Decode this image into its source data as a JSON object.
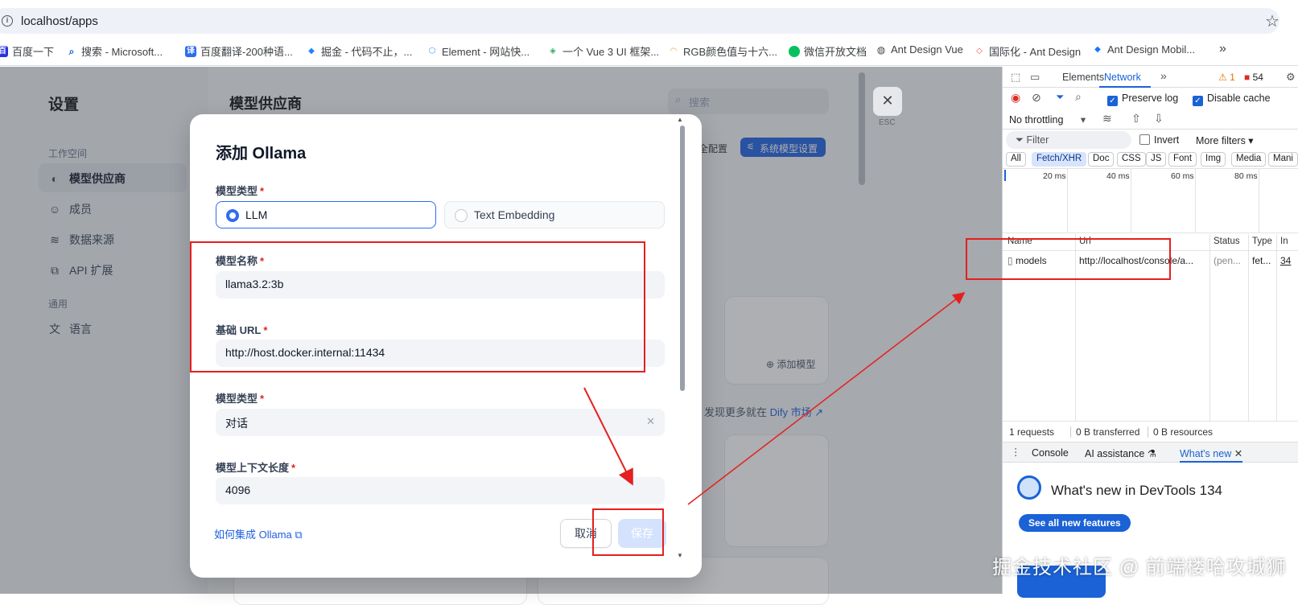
{
  "browser": {
    "url": "localhost/apps",
    "bookmarks": [
      {
        "label": "百度一下",
        "icon": "baidu-icon",
        "color": "#2932e1"
      },
      {
        "label": "搜索 - Microsoft...",
        "icon": "search-icon",
        "color": "#1a62d6"
      },
      {
        "label": "百度翻译-200种语...",
        "icon": "translate-icon",
        "color": "#2a6cf0"
      },
      {
        "label": "掘金 - 代码不止，...",
        "icon": "juejin-icon",
        "color": "#1e80ff"
      },
      {
        "label": "Element - 网站快...",
        "icon": "element-icon",
        "color": "#409eff"
      },
      {
        "label": "一个 Vue 3 UI 框架...",
        "icon": "naive-ui-icon",
        "color": "#36ad6a"
      },
      {
        "label": "RGB颜色值与十六...",
        "icon": "rainbow-icon",
        "color": "#e8a23a"
      },
      {
        "label": "微信开放文档",
        "icon": "wechat-icon",
        "color": "#07c160"
      },
      {
        "label": "Ant Design Vue",
        "icon": "globe-icon",
        "color": "#444444"
      },
      {
        "label": "国际化 - Ant Design",
        "icon": "antd-icon",
        "color": "#f04f4f"
      },
      {
        "label": "Ant Design Mobil...",
        "icon": "antd-mobile-icon",
        "color": "#1677ff"
      }
    ],
    "overflow": "»"
  },
  "sidebar": {
    "title": "设置",
    "group_workspace": "工作空间",
    "items": [
      {
        "label": "模型供应商",
        "icon": "brain-icon"
      },
      {
        "label": "成员",
        "icon": "members-icon"
      },
      {
        "label": "数据来源",
        "icon": "database-icon"
      },
      {
        "label": "API 扩展",
        "icon": "puzzle-icon"
      }
    ],
    "group_general": "通用",
    "language": {
      "label": "语言",
      "icon": "translate-icon"
    }
  },
  "main": {
    "title": "模型供应商",
    "search_placeholder": "搜索",
    "safe_config": "全配置",
    "system_model_settings": "系统模型设置",
    "add_model": "添加模型",
    "discover_prefix": "发现更多就在",
    "discover_link": "Dify 市场",
    "close_hint": "ESC"
  },
  "modal": {
    "title": "添加 Ollama",
    "model_type_label": "模型类型",
    "model_type_options": [
      "LLM",
      "Text Embedding"
    ],
    "model_type_selected": "LLM",
    "model_name_label": "模型名称",
    "model_name_value": "llama3.2:3b",
    "base_url_label": "基础 URL",
    "base_url_value": "http://host.docker.internal:11434",
    "completion_type_label": "模型类型",
    "completion_type_value": "对话",
    "context_length_label": "模型上下文长度",
    "context_length_value": "4096",
    "doc_link": "如何集成 Ollama",
    "cancel": "取消",
    "save": "保存",
    "required_mark": "*"
  },
  "devtools": {
    "tabs": [
      "Elements",
      "Network"
    ],
    "active_tab": "Network",
    "warnings": "1",
    "errors": "54",
    "preserve_log": "Preserve log",
    "disable_cache": "Disable cache",
    "throttling": "No throttling",
    "filter_placeholder": "Filter",
    "invert": "Invert",
    "more_filters": "More filters",
    "type_filters": [
      "All",
      "Fetch/XHR",
      "Doc",
      "CSS",
      "JS",
      "Font",
      "Img",
      "Media",
      "Mani"
    ],
    "active_type_filter": "Fetch/XHR",
    "timeline_ticks": [
      "20 ms",
      "40 ms",
      "60 ms",
      "80 ms"
    ],
    "columns": [
      "Name",
      "Url",
      "Status",
      "Type",
      "In"
    ],
    "rows": [
      {
        "name": "models",
        "url": "http://localhost/console/a...",
        "status": "(pen...",
        "type": "fet...",
        "initiator": "34"
      }
    ],
    "summary": [
      "1 requests",
      "0 B transferred",
      "0 B resources"
    ],
    "drawer_tabs": [
      "Console",
      "AI assistance",
      "What's new"
    ],
    "whats_new_title": "What's new in DevTools 134",
    "see_all": "See all new features"
  },
  "watermark": "掘金技术社区 @ 前端楼哈攻城狮",
  "colors": {
    "accent": "#1d5fe0",
    "annotation": "#e51f1f"
  }
}
